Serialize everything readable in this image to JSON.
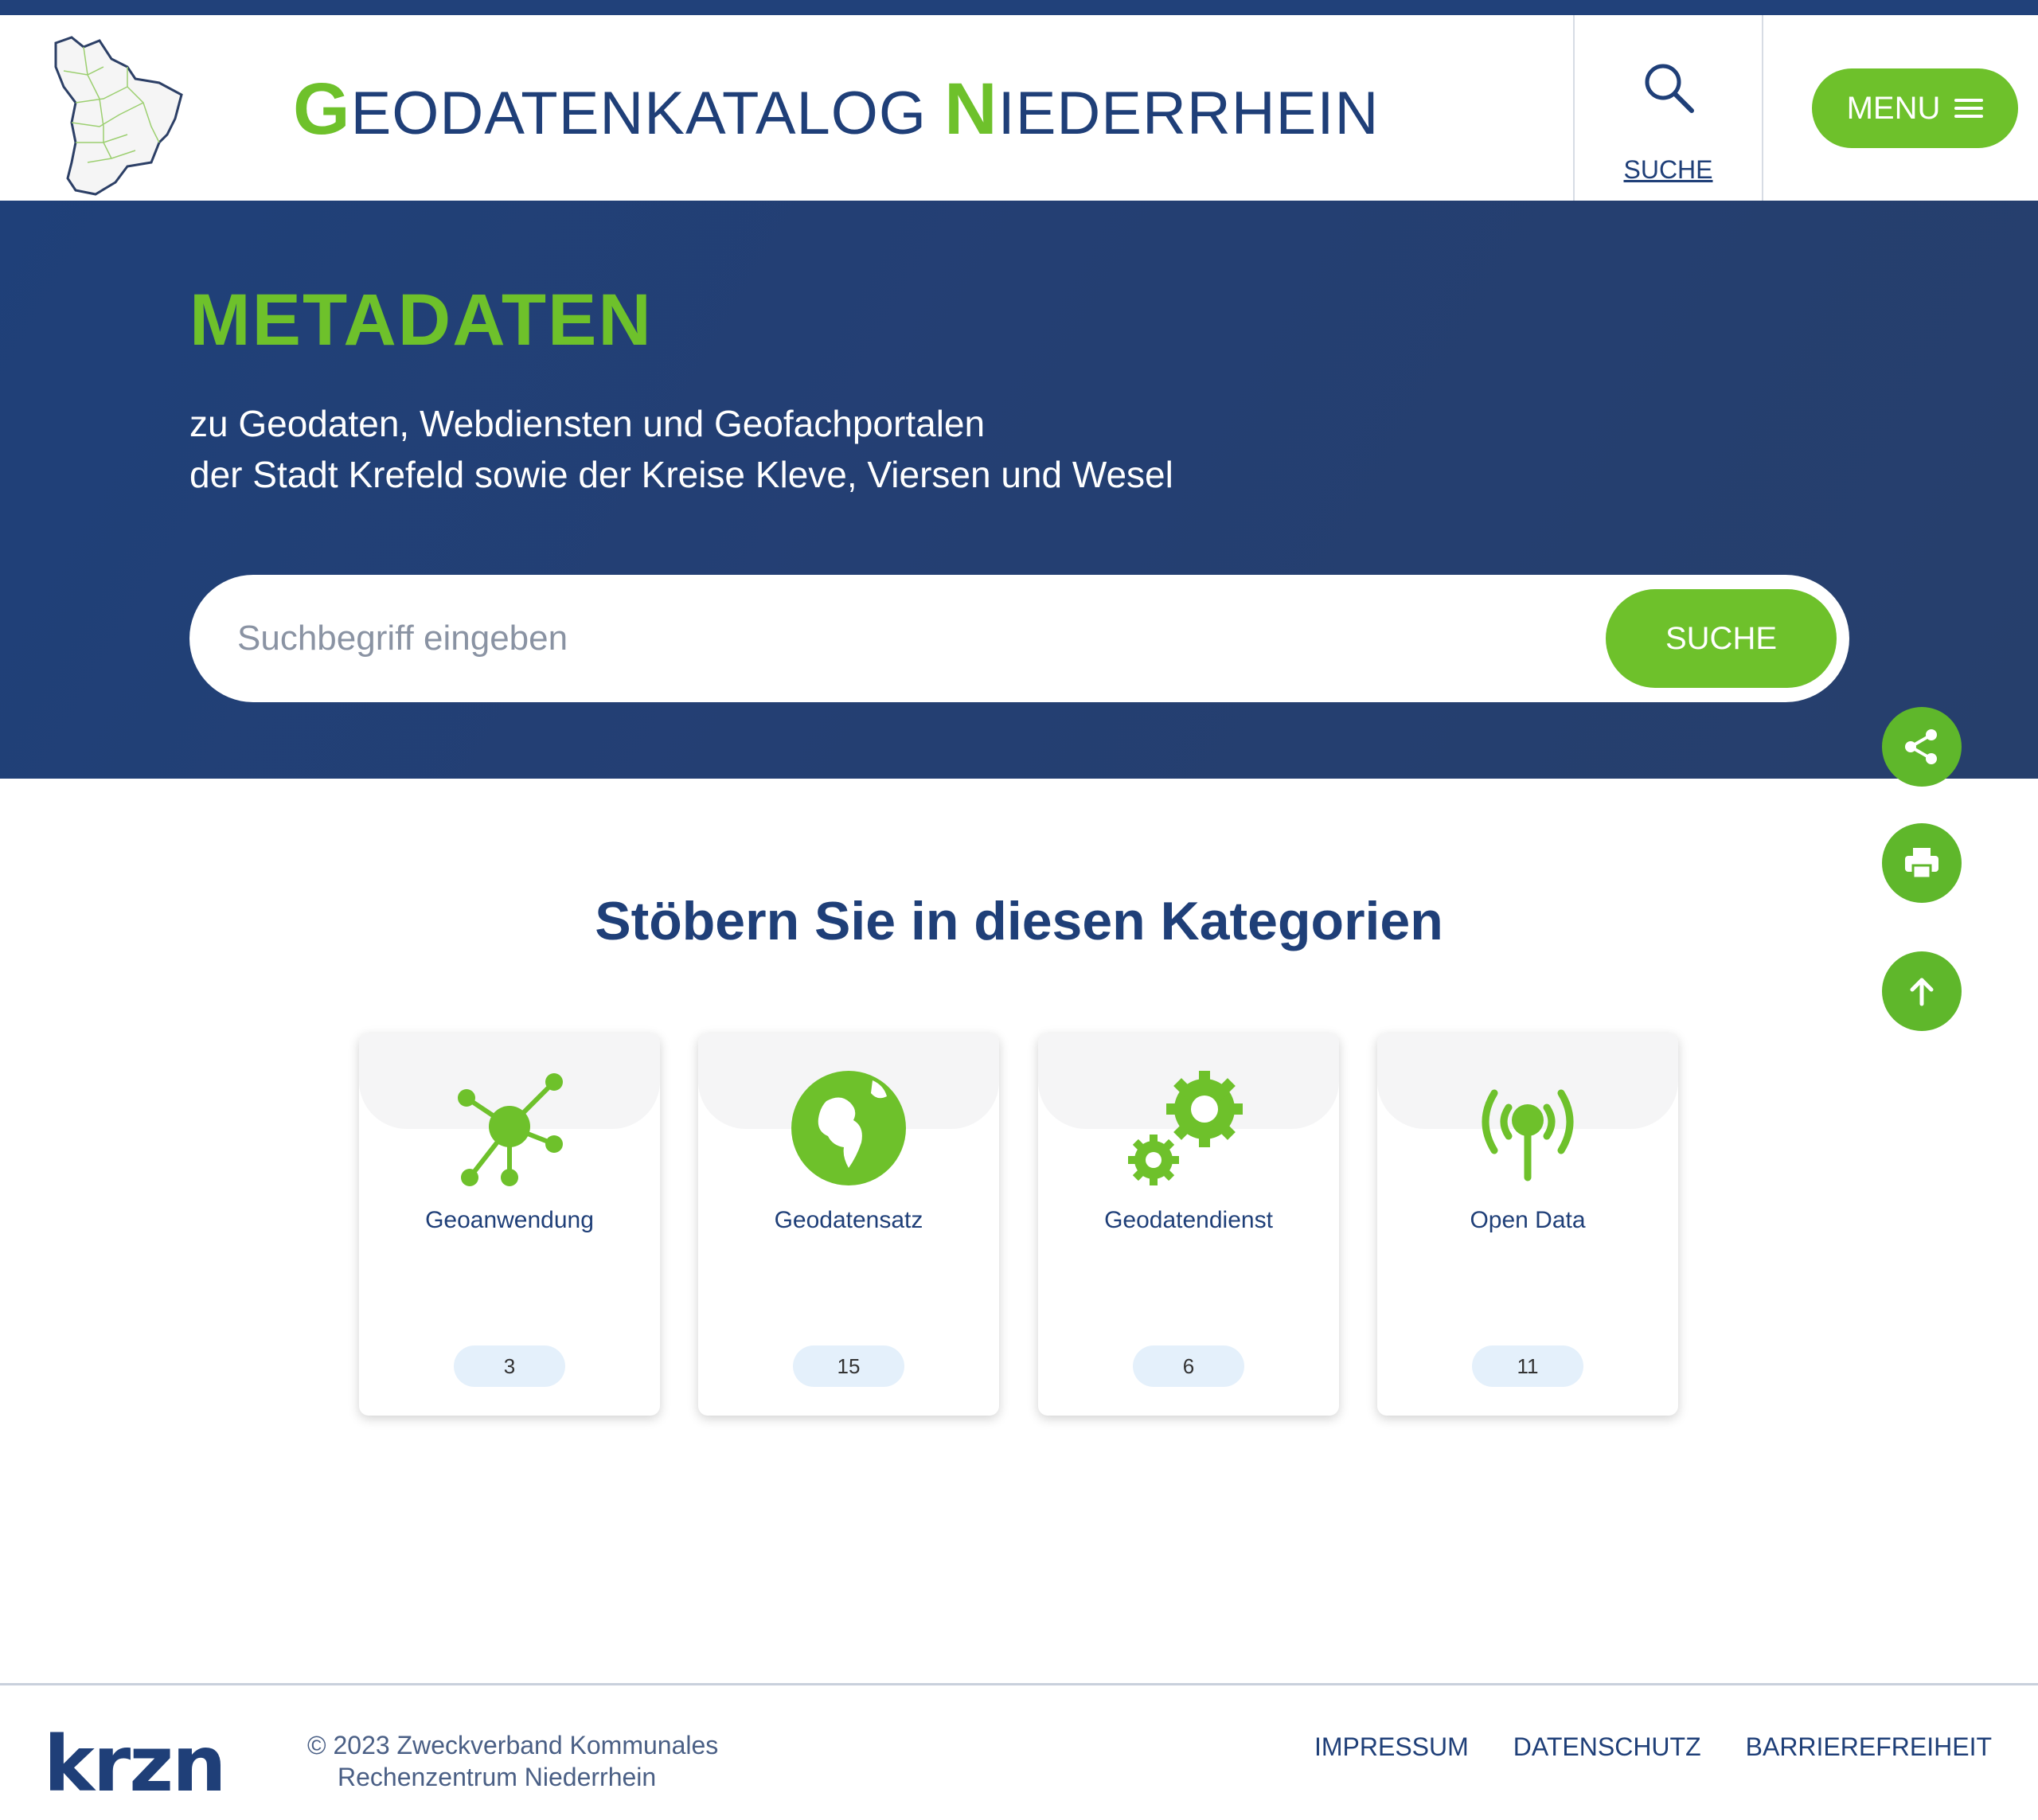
{
  "header": {
    "title_parts": [
      {
        "cap": "G",
        "rest": "EODATENKATALOG "
      },
      {
        "cap": "N",
        "rest": "IEDERRHEIN"
      }
    ],
    "search_label": "SUCHE",
    "menu_label": "MENU"
  },
  "hero": {
    "title": "METADATEN",
    "subtitle_line1": "zu Geodaten, Webdiensten und Geofachportalen",
    "subtitle_line2": "der Stadt Krefeld sowie der Kreise Kleve, Viersen und Wesel",
    "search_placeholder": "Suchbegriff eingeben",
    "search_button": "SUCHE"
  },
  "categories": {
    "title": "Stöbern Sie in diesen Kategorien",
    "items": [
      {
        "label": "Geoanwendung",
        "count": "3",
        "icon": "network-icon"
      },
      {
        "label": "Geodatensatz",
        "count": "15",
        "icon": "globe-icon"
      },
      {
        "label": "Geodatendienst",
        "count": "6",
        "icon": "gears-icon"
      },
      {
        "label": "Open Data",
        "count": "11",
        "icon": "broadcast-icon"
      }
    ]
  },
  "floating_actions": [
    {
      "name": "share-icon"
    },
    {
      "name": "print-icon"
    },
    {
      "name": "arrow-up-icon"
    }
  ],
  "footer": {
    "logo_text": "krzn",
    "copyright_line1": "© 2023 Zweckverband Kommunales",
    "copyright_line2": "Rechenzentrum Niederrhein",
    "links": [
      "IMPRESSUM",
      "DATENSCHUTZ",
      "BARRIEREFREIHEIT"
    ]
  },
  "colors": {
    "brand_blue": "#21417a",
    "brand_green": "#6ec12b",
    "count_badge": "#e4f0fb"
  }
}
